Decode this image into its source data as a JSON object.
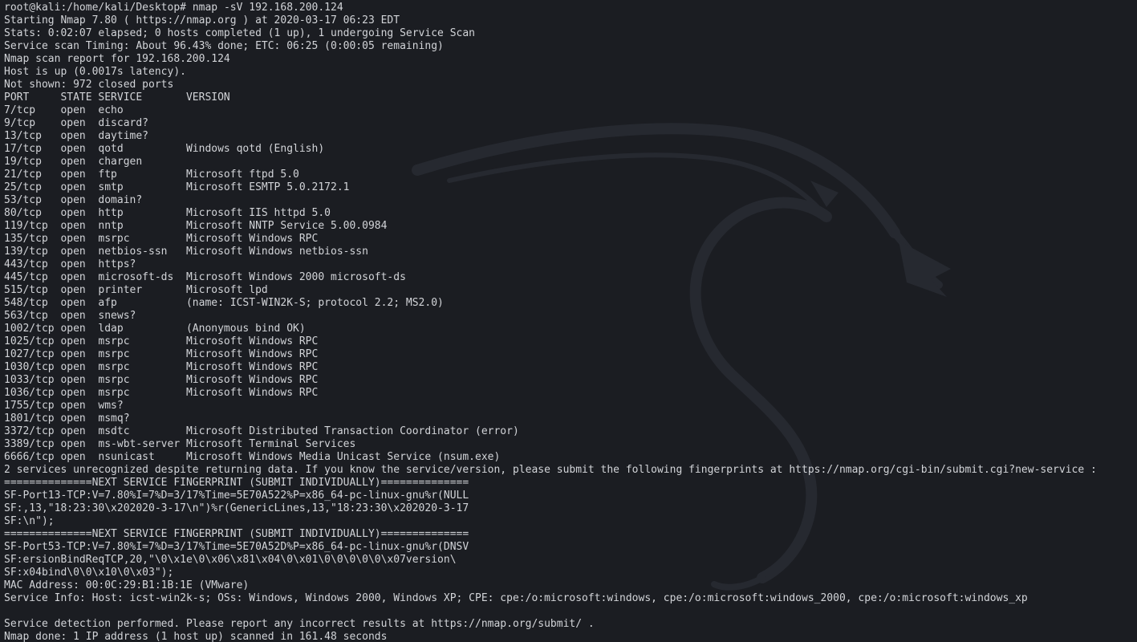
{
  "colors": {
    "background": "#1b1d22",
    "foreground": "#d2d4d8",
    "wallpaper_logo": "#2a2d33"
  },
  "wallpaper": {
    "icon": "kali-dragon-logo-icon"
  },
  "terminal": {
    "prompt": "root@kali:/home/kali/Desktop#",
    "command": "nmap -sV 192.168.200.124",
    "lines": [
      "Starting Nmap 7.80 ( https://nmap.org ) at 2020-03-17 06:23 EDT",
      "Stats: 0:02:07 elapsed; 0 hosts completed (1 up), 1 undergoing Service Scan",
      "Service scan Timing: About 96.43% done; ETC: 06:25 (0:00:05 remaining)",
      "Nmap scan report for 192.168.200.124",
      "Host is up (0.0017s latency).",
      "Not shown: 972 closed ports",
      "PORT     STATE SERVICE       VERSION",
      "7/tcp    open  echo",
      "9/tcp    open  discard?",
      "13/tcp   open  daytime?",
      "17/tcp   open  qotd          Windows qotd (English)",
      "19/tcp   open  chargen",
      "21/tcp   open  ftp           Microsoft ftpd 5.0",
      "25/tcp   open  smtp          Microsoft ESMTP 5.0.2172.1",
      "53/tcp   open  domain?",
      "80/tcp   open  http          Microsoft IIS httpd 5.0",
      "119/tcp  open  nntp          Microsoft NNTP Service 5.00.0984",
      "135/tcp  open  msrpc         Microsoft Windows RPC",
      "139/tcp  open  netbios-ssn   Microsoft Windows netbios-ssn",
      "443/tcp  open  https?",
      "445/tcp  open  microsoft-ds  Microsoft Windows 2000 microsoft-ds",
      "515/tcp  open  printer       Microsoft lpd",
      "548/tcp  open  afp           (name: ICST-WIN2K-S; protocol 2.2; MS2.0)",
      "563/tcp  open  snews?",
      "1002/tcp open  ldap          (Anonymous bind OK)",
      "1025/tcp open  msrpc         Microsoft Windows RPC",
      "1027/tcp open  msrpc         Microsoft Windows RPC",
      "1030/tcp open  msrpc         Microsoft Windows RPC",
      "1033/tcp open  msrpc         Microsoft Windows RPC",
      "1036/tcp open  msrpc         Microsoft Windows RPC",
      "1755/tcp open  wms?",
      "1801/tcp open  msmq?",
      "3372/tcp open  msdtc         Microsoft Distributed Transaction Coordinator (error)",
      "3389/tcp open  ms-wbt-server Microsoft Terminal Services",
      "6666/tcp open  nsunicast     Microsoft Windows Media Unicast Service (nsum.exe)",
      "2 services unrecognized despite returning data. If you know the service/version, please submit the following fingerprints at https://nmap.org/cgi-bin/submit.cgi?new-service :",
      "==============NEXT SERVICE FINGERPRINT (SUBMIT INDIVIDUALLY)==============",
      "SF-Port13-TCP:V=7.80%I=7%D=3/17%Time=5E70A522%P=x86_64-pc-linux-gnu%r(NULL",
      "SF:,13,\"18:23:30\\x202020-3-17\\n\")%r(GenericLines,13,\"18:23:30\\x202020-3-17",
      "SF:\\n\");",
      "==============NEXT SERVICE FINGERPRINT (SUBMIT INDIVIDUALLY)==============",
      "SF-Port53-TCP:V=7.80%I=7%D=3/17%Time=5E70A52D%P=x86_64-pc-linux-gnu%r(DNSV",
      "SF:ersionBindReqTCP,20,\"\\0\\x1e\\0\\x06\\x81\\x04\\0\\x01\\0\\0\\0\\0\\0\\x07version\\",
      "SF:x04bind\\0\\0\\x10\\0\\x03\");",
      "MAC Address: 00:0C:29:B1:1B:1E (VMware)",
      "Service Info: Host: icst-win2k-s; OSs: Windows, Windows 2000, Windows XP; CPE: cpe:/o:microsoft:windows, cpe:/o:microsoft:windows_2000, cpe:/o:microsoft:windows_xp",
      "",
      "Service detection performed. Please report any incorrect results at https://nmap.org/submit/ .",
      "Nmap done: 1 IP address (1 host up) scanned in 161.48 seconds"
    ]
  }
}
